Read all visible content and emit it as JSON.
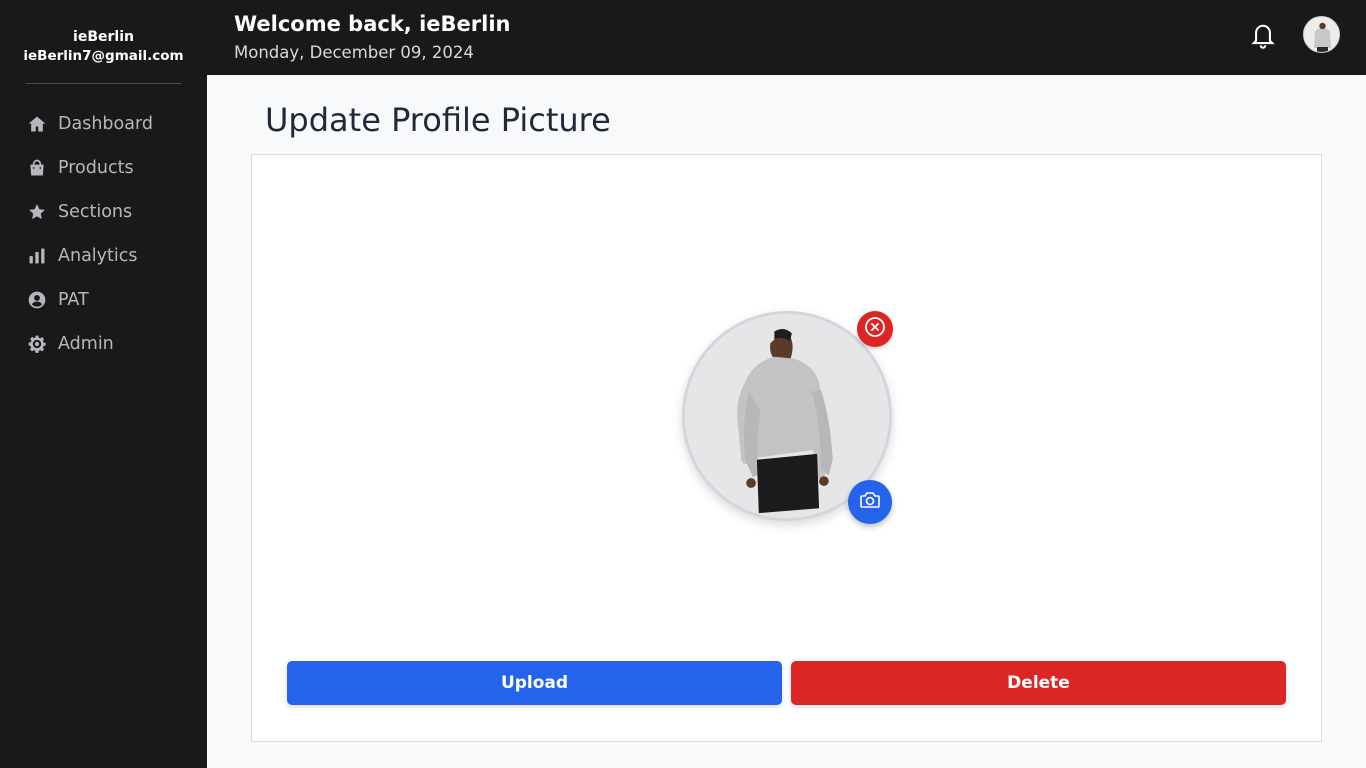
{
  "user": {
    "name": "ieBerlin",
    "email": "ieBerlin7@gmail.com"
  },
  "nav": [
    {
      "label": "Dashboard",
      "icon": "home-icon"
    },
    {
      "label": "Products",
      "icon": "shopping-bag-icon"
    },
    {
      "label": "Sections",
      "icon": "star-icon"
    },
    {
      "label": "Analytics",
      "icon": "bar-chart-icon"
    },
    {
      "label": "PAT",
      "icon": "user-circle-icon"
    },
    {
      "label": "Admin",
      "icon": "gear-icon"
    }
  ],
  "header": {
    "welcome": "Welcome back, ieBerlin",
    "date": "Monday, December 09, 2024"
  },
  "page": {
    "title": "Update Profile Picture"
  },
  "actions": {
    "upload_label": "Upload",
    "delete_label": "Delete"
  },
  "colors": {
    "sidebar_bg": "#191919",
    "primary": "#2563eb",
    "danger": "#dc2626"
  }
}
